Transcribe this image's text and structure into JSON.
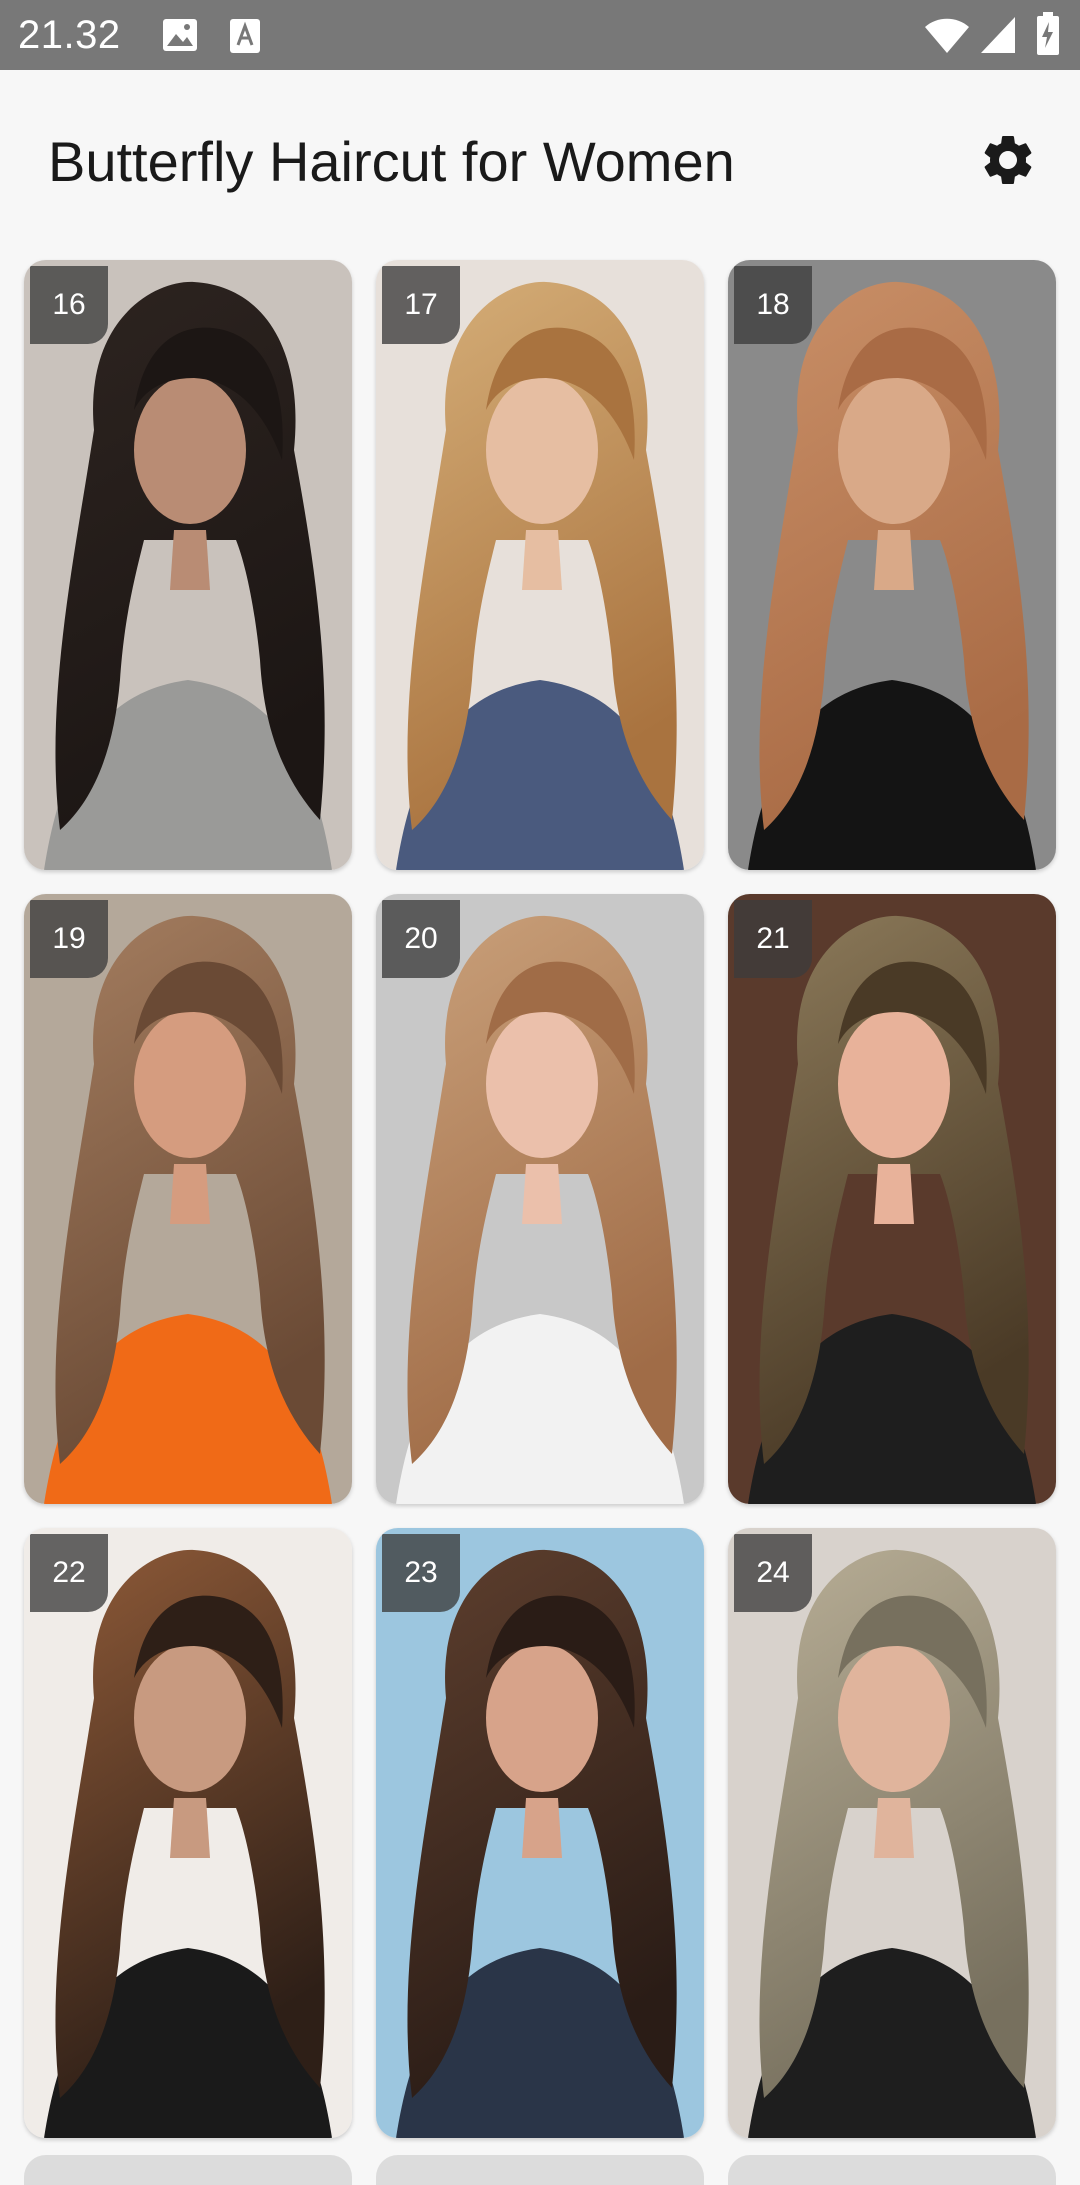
{
  "status_bar": {
    "time": "21.32",
    "icons": [
      "image-icon",
      "font-a-icon",
      "wifi-icon",
      "signal-icon",
      "battery-charging-icon"
    ]
  },
  "app_bar": {
    "title": "Butterfly Haircut for Women",
    "settings_icon": "gear-icon"
  },
  "grid": {
    "items": [
      {
        "number": "16",
        "image": "woman-dark-hair-face-mask",
        "bg": "#c9c2bc",
        "hair": "#1c1614",
        "hair2": "#2d2420",
        "body": "#9a9a98",
        "skin": "#b98c74"
      },
      {
        "number": "17",
        "image": "woman-golden-brown-layered-hair-profile",
        "bg": "#e7e0da",
        "hair": "#a9733f",
        "hair2": "#d5ae78",
        "body": "#4a5a7e",
        "skin": "#e6bea2"
      },
      {
        "number": "18",
        "image": "back-view-copper-brown-layered-hair",
        "bg": "#8a8a8a",
        "hair": "#a96b45",
        "hair2": "#c98f67",
        "body": "#141414",
        "skin": "#d9a988"
      },
      {
        "number": "19",
        "image": "woman-brown-balayage-orange-top",
        "bg": "#b4a89a",
        "hair": "#6a4a35",
        "hair2": "#a47d5f",
        "body": "#f06a17",
        "skin": "#d59c7f"
      },
      {
        "number": "20",
        "image": "woman-honey-brown-hair-bangs-profile",
        "bg": "#c8c8c8",
        "hair": "#a06c47",
        "hair2": "#c9a07a",
        "body": "#f2f2f2",
        "skin": "#ebc0ab"
      },
      {
        "number": "21",
        "image": "smiling-woman-bronde-curtain-bangs",
        "bg": "#5a3a2c",
        "hair": "#4a3a26",
        "hair2": "#8c7a5a",
        "body": "#1e1e1e",
        "skin": "#e8b29a"
      },
      {
        "number": "22",
        "image": "woman-dark-brown-caramel-highlights",
        "bg": "#f0ece8",
        "hair": "#2e1f17",
        "hair2": "#8e5a38",
        "body": "#1a1a1a",
        "skin": "#c89a80"
      },
      {
        "number": "23",
        "image": "woman-chocolate-brown-layers-navy-top",
        "bg": "#9cc6df",
        "hair": "#2a1c16",
        "hair2": "#5e3f2e",
        "body": "#2a3548",
        "skin": "#d7a38a"
      },
      {
        "number": "24",
        "image": "smiling-woman-ash-blonde-long-layers",
        "bg": "#d8d2cc",
        "hair": "#77705e",
        "hair2": "#b8ae96",
        "body": "#1e1e1e",
        "skin": "#e0b49c"
      }
    ]
  }
}
